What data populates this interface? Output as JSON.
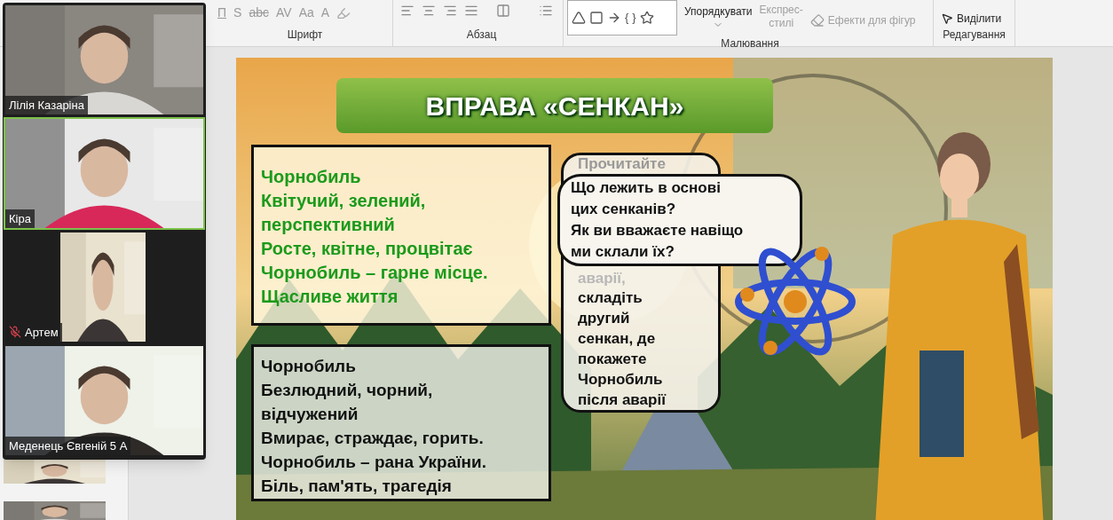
{
  "ribbon": {
    "font_group": {
      "label": "Шрифт",
      "glyph_buttons": [
        "П",
        "S",
        "abc",
        "AV",
        "Aa",
        "A"
      ]
    },
    "paragraph_group": {
      "label": "Абзац"
    },
    "drawing_group": {
      "label": "Малювання",
      "gallery_glyphs": [
        "{",
        "}"
      ],
      "arrange": "Упорядкувати",
      "quick_styles": [
        "Експрес-",
        "стилі"
      ],
      "effects": "Ефекти для фігур"
    },
    "editing_group": {
      "label": "Редагування",
      "select": "Виділити"
    }
  },
  "slide": {
    "title": "ВПРАВА «СЕНКАН»",
    "poem_before": [
      "Чорнобиль",
      "Квітучий, зелений,",
      "перспективний",
      "Росте, квітне, процвітає",
      "Чорнобиль – гарне місце.",
      "Щасливе життя"
    ],
    "poem_after": [
      "Чорнобиль",
      "Безлюдний, чорний,",
      "відчужений",
      "Вмирає, страждає, горить.",
      "Чорнобиль – рана України.",
      "Біль, пам'ять, трагедія"
    ],
    "back_bubble": {
      "faded_top": "Прочитайте",
      "faded_middle": "аварії,",
      "lines": [
        "складіть",
        "другий",
        "сенкан, де",
        "покажете",
        "Чорнобиль",
        "після аварії"
      ]
    },
    "front_bubble": {
      "lines": [
        "Що лежить в основі",
        "цих сенканів?",
        "Як ви вважаєте навіщо",
        "ми склали їх?"
      ]
    }
  },
  "participants": [
    {
      "name": "Лілія Казаріна",
      "muted": false,
      "active": false,
      "portrait": false
    },
    {
      "name": "Кіра",
      "muted": false,
      "active": true,
      "portrait": false
    },
    {
      "name": "Артем",
      "muted": true,
      "active": false,
      "portrait": true
    },
    {
      "name": "Меденець Євгеній 5 А",
      "muted": false,
      "active": false,
      "portrait": false
    }
  ]
}
